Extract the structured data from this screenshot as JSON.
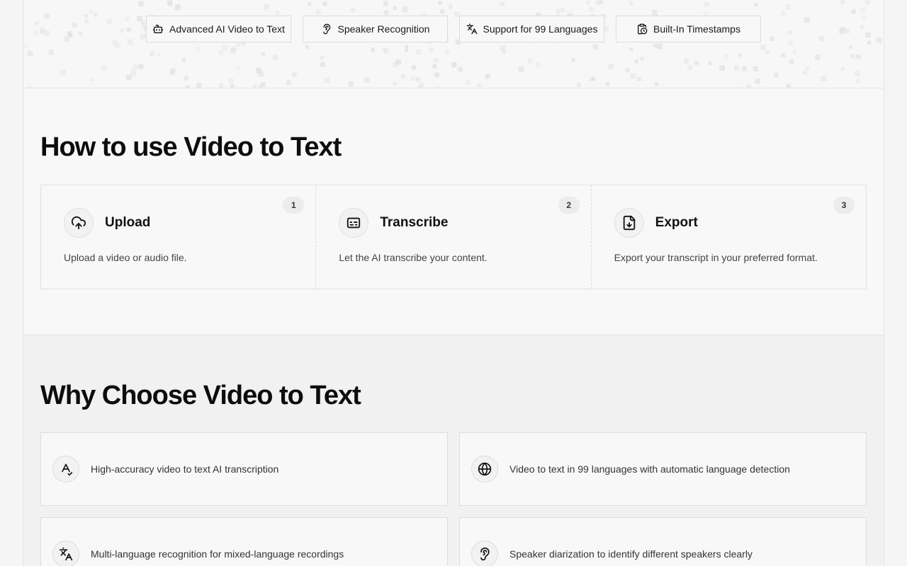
{
  "hero": {
    "features": [
      {
        "label": "Advanced AI Video to Text",
        "icon": "bot-icon"
      },
      {
        "label": "Speaker Recognition",
        "icon": "speaker-icon"
      },
      {
        "label": "Support for 99 Languages",
        "icon": "translate-icon"
      },
      {
        "label": "Built-In Timestamps",
        "icon": "clipboard-clock-icon"
      }
    ]
  },
  "how": {
    "title": "How to use Video to Text",
    "steps": [
      {
        "number": "1",
        "title": "Upload",
        "description": "Upload a video or audio file.",
        "icon": "upload-cloud-icon"
      },
      {
        "number": "2",
        "title": "Transcribe",
        "description": "Let the AI transcribe your content.",
        "icon": "captions-icon"
      },
      {
        "number": "3",
        "title": "Export",
        "description": "Export your transcript in your preferred format.",
        "icon": "file-download-icon"
      }
    ]
  },
  "why": {
    "title": "Why Choose Video to Text",
    "items": [
      {
        "text": "High-accuracy video to text AI transcription",
        "icon": "spell-check-icon"
      },
      {
        "text": "Video to text in 99 languages with automatic language detection",
        "icon": "globe-icon"
      },
      {
        "text": "Multi-language recognition for mixed-language recordings",
        "icon": "translate-icon"
      },
      {
        "text": "Speaker diarization to identify different speakers clearly",
        "icon": "speaker-icon"
      }
    ]
  },
  "colors": {
    "background": "#f7f7f7",
    "border": "#e3e3e3",
    "text": "#111111"
  }
}
